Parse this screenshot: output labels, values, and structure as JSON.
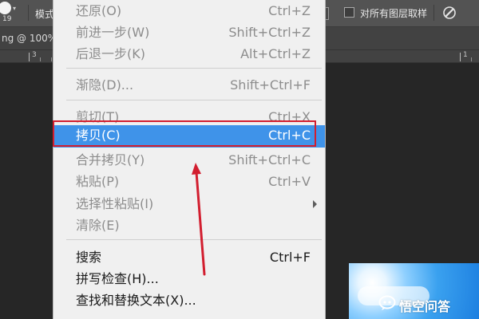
{
  "options_bar": {
    "brush_size": "19",
    "mode_label": "模式",
    "sample_all_layers_label": "对所有图层取样"
  },
  "document_tab": {
    "title": "ng @ 100% ("
  },
  "ruler": {
    "numbers": [
      "3",
      "1"
    ]
  },
  "menu": {
    "items": [
      {
        "label": "还原(O)",
        "shortcut": "Ctrl+Z",
        "state": "disabled"
      },
      {
        "label": "前进一步(W)",
        "shortcut": "Shift+Ctrl+Z",
        "state": "disabled"
      },
      {
        "label": "后退一步(K)",
        "shortcut": "Alt+Ctrl+Z",
        "state": "disabled"
      },
      {
        "label": "渐隐(D)...",
        "shortcut": "Shift+Ctrl+F",
        "state": "disabled"
      },
      {
        "label": "剪切(T)",
        "shortcut": "Ctrl+X",
        "state": "disabled"
      },
      {
        "label": "拷贝(C)",
        "shortcut": "Ctrl+C",
        "state": "selected"
      },
      {
        "label": "合并拷贝(Y)",
        "shortcut": "Shift+Ctrl+C",
        "state": "disabled"
      },
      {
        "label": "粘贴(P)",
        "shortcut": "Ctrl+V",
        "state": "disabled"
      },
      {
        "label": "选择性粘贴(I)",
        "shortcut": "",
        "state": "disabled"
      },
      {
        "label": "清除(E)",
        "shortcut": "",
        "state": "disabled"
      },
      {
        "label": "搜索",
        "shortcut": "Ctrl+F",
        "state": "enabled"
      },
      {
        "label": "拼写检查(H)...",
        "shortcut": "",
        "state": "enabled"
      },
      {
        "label": "查找和替换文本(X)...",
        "shortcut": "",
        "state": "enabled"
      }
    ]
  },
  "watermark": {
    "text": "悟空问答"
  },
  "colors": {
    "menu_bg": "#f0f0f0",
    "selected_bg": "#3f93e9",
    "annotation_red": "#d21e2f",
    "options_bar_bg": "#535353",
    "canvas_bg": "#262626"
  }
}
